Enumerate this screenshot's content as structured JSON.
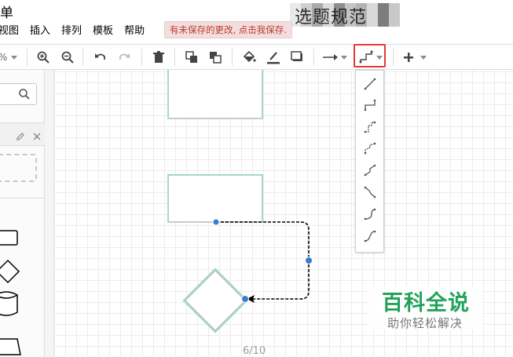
{
  "app": {
    "title_fragment": "单"
  },
  "document": {
    "title": "选题规范"
  },
  "menu": {
    "items": [
      {
        "label": "视图"
      },
      {
        "label": "插入"
      },
      {
        "label": "排列"
      },
      {
        "label": "模板"
      },
      {
        "label": "帮助"
      }
    ]
  },
  "notice": {
    "unsaved": "有未保存的更改, 点击我保存."
  },
  "toolbar": {
    "icons": [
      "zoom-in-icon",
      "zoom-out-icon",
      "undo-icon",
      "redo-icon",
      "delete-icon",
      "to-front-icon",
      "to-back-icon",
      "fill-color-icon",
      "line-color-icon",
      "shadow-icon",
      "connection-icon",
      "waypoints-icon",
      "insert-icon"
    ]
  },
  "sidebar": {
    "search_placeholder": ""
  },
  "waypoint_menu": {
    "options": [
      "straight-waypoint-icon",
      "orthogonal-waypoint-icon",
      "simple-waypoint-icon",
      "isometric-waypoint-icon",
      "curved-waypoint-icon",
      "entity-relation-waypoint-icon",
      "horizontal-waypoint-icon",
      "vertical-waypoint-icon"
    ]
  },
  "canvas": {
    "page_indicator": "6/10"
  },
  "watermark": {
    "main": "百科全说",
    "sub": "助你轻松解决"
  },
  "colors": {
    "accent": "#3a7bd5",
    "highlight_box": "#e53935",
    "unsaved_text": "#c0392b",
    "watermark": "#22a35a",
    "shape_stroke": "#a8d8c4"
  }
}
